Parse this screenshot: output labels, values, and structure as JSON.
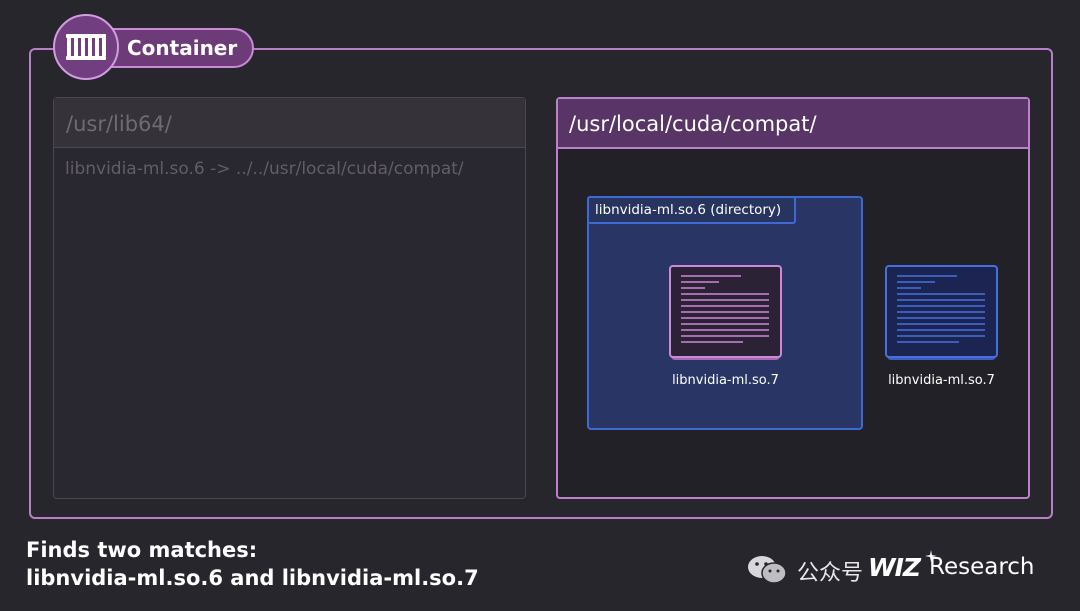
{
  "container": {
    "label": "Container",
    "icon": "container-icon"
  },
  "left_panel": {
    "title": "/usr/lib64/",
    "entry": "libnvidia-ml.so.6 -> ../../usr/local/cuda/compat/"
  },
  "right_panel": {
    "title": "/usr/local/cuda/compat/",
    "directory_label": "libnvidia-ml.so.6 (directory)",
    "files": [
      {
        "label": "libnvidia-ml.so.7",
        "icon": "file-icon",
        "color": "#cf88d9"
      },
      {
        "label": "libnvidia-ml.so.7",
        "icon": "file-icon",
        "color": "#4671dd"
      }
    ]
  },
  "caption": {
    "line1": "Finds two matches:",
    "line2": "libnvidia-ml.so.6 and libnvidia-ml.so.7"
  },
  "watermark": {
    "icon": "wechat-icon",
    "text": "公众号",
    "brand": "WIZ",
    "brand_suffix": "Research"
  },
  "colors": {
    "background": "#28262d",
    "accent_purple": "#b67fc7",
    "directory_blue": "#3e69d2"
  }
}
